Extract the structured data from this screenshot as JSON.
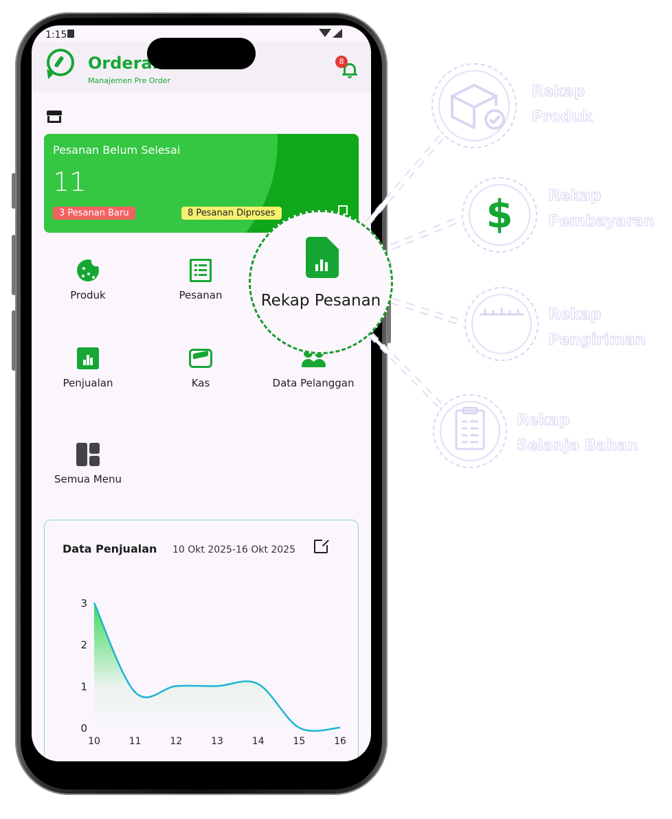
{
  "status": {
    "time": "1:15"
  },
  "header": {
    "app_name": "Orderan",
    "subtitle": "Manajemen Pre Order",
    "notif_count": "8"
  },
  "orders_card": {
    "title": "Pesanan Belum Selesai",
    "count": "11",
    "new_label": "3 Pesanan Baru",
    "process_label": "8 Pesanan Diproses"
  },
  "menu": {
    "produk": "Produk",
    "pesanan": "Pesanan",
    "penjualan": "Penjualan",
    "kas": "Kas",
    "pelanggan": "Data Pelanggan",
    "semua": "Semua Menu"
  },
  "sales": {
    "title": "Data Penjualan",
    "range": "10 Okt 2025-16 Okt 2025"
  },
  "chart_data": {
    "type": "area",
    "title": "Data Penjualan",
    "x": [
      10,
      11,
      12,
      13,
      14,
      15,
      16
    ],
    "values": [
      3,
      0.85,
      1,
      1,
      1.05,
      0,
      0
    ],
    "ylim": [
      0,
      3
    ],
    "yticks": [
      0,
      1,
      2,
      3
    ],
    "colors": {
      "line": "#1eb4d4",
      "fill_top": "#27d645"
    }
  },
  "magnifier": {
    "label": "Rekap Pesanan"
  },
  "callouts": [
    {
      "line1": "Rekap",
      "line2": "Produk",
      "icon": "box-check-icon"
    },
    {
      "line1": "Rekap",
      "line2": "Pembayaran",
      "icon": "dollar-icon"
    },
    {
      "line1": "Rekap",
      "line2": "Pengiriman",
      "icon": "ruler-icon"
    },
    {
      "line1": "Rekap",
      "line2": "Selanja Bahan",
      "icon": "clipboard-list-icon"
    }
  ]
}
